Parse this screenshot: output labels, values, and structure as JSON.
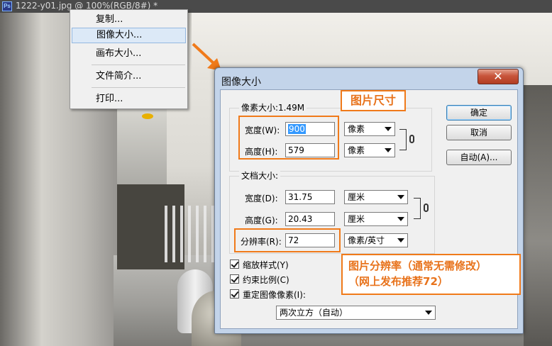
{
  "window": {
    "doc_title": "1222-y01.jpg @ 100%(RGB/8#) *",
    "app_icon_text": "Ps"
  },
  "context_menu": {
    "items": [
      {
        "label": "复制..."
      },
      {
        "label": "图像大小...",
        "highlighted": true
      },
      {
        "label": "画布大小..."
      },
      {
        "label": "文件简介..."
      },
      {
        "label": "打印..."
      }
    ]
  },
  "dialog": {
    "title": "图像大小",
    "close_symbol": "✕",
    "pixel_group": {
      "label": "像素大小:1.49M",
      "width_label": "宽度(W):",
      "width_value": "900",
      "width_unit": "像素",
      "height_label": "高度(H):",
      "height_value": "579",
      "height_unit": "像素"
    },
    "doc_group": {
      "label": "文档大小:",
      "width_label": "宽度(D):",
      "width_value": "31.75",
      "width_unit": "厘米",
      "height_label": "高度(G):",
      "height_value": "20.43",
      "height_unit": "厘米",
      "res_label": "分辨率(R):",
      "res_value": "72",
      "res_unit": "像素/英寸"
    },
    "buttons": {
      "ok": "确定",
      "cancel": "取消",
      "auto": "自动(A)..."
    },
    "options": {
      "scale_styles": "缩放样式(Y)",
      "constrain": "约束比例(C)",
      "resample": "重定图像像素(I):",
      "resample_method": "两次立方（自动）"
    }
  },
  "callouts": {
    "size_note": "图片尺寸",
    "res_note_line1": "图片分辨率（通常无需修改）",
    "res_note_line2": "（网上发布推荐72）"
  },
  "colors": {
    "callout": "#f07a1a",
    "selection": "#3399ff",
    "dialog_frame": "#c3d4ea",
    "close_button": "#c8553b"
  }
}
